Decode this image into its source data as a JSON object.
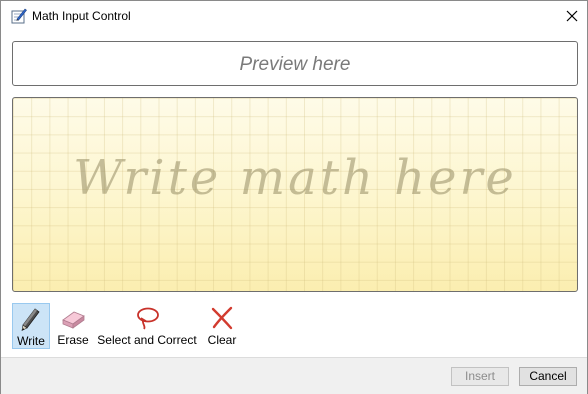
{
  "window": {
    "title": "Math Input Control"
  },
  "preview": {
    "placeholder": "Preview here"
  },
  "write_area": {
    "hint": "Write math here"
  },
  "toolbar": {
    "items": [
      {
        "label": "Write",
        "icon": "pen-icon",
        "active": true
      },
      {
        "label": "Erase",
        "icon": "eraser-icon",
        "active": false
      },
      {
        "label": "Select and Correct",
        "icon": "lasso-icon",
        "active": false
      },
      {
        "label": "Clear",
        "icon": "clear-x-icon",
        "active": false
      }
    ]
  },
  "footer": {
    "insert_label": "Insert",
    "insert_enabled": false,
    "cancel_label": "Cancel"
  },
  "colors": {
    "accent_selected": "#cce4f7",
    "writing_pad": "#fdf4c6",
    "clear_red": "#d23b2f"
  }
}
